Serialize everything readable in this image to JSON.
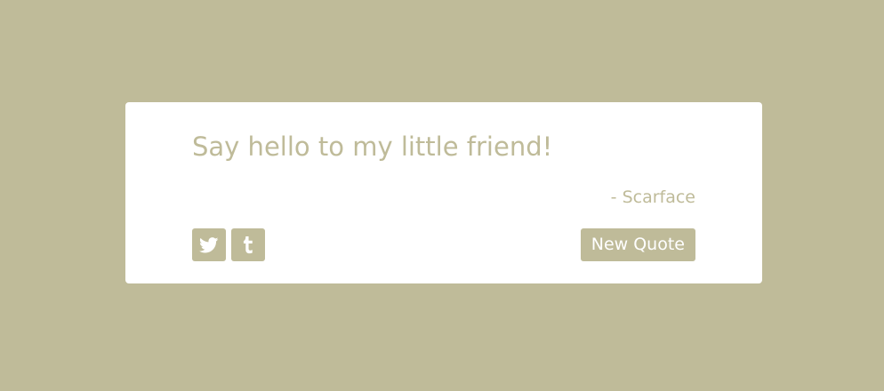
{
  "theme": {
    "background_color": "#bfbb99",
    "card_color": "#ffffff",
    "accent_color": "#bfbb99"
  },
  "quote": {
    "text": "Say hello to my little friend!",
    "author": "- Scarface"
  },
  "actions": {
    "twitter_icon": "twitter-icon",
    "tumblr_icon": "tumblr-icon",
    "new_quote_label": "New Quote"
  }
}
